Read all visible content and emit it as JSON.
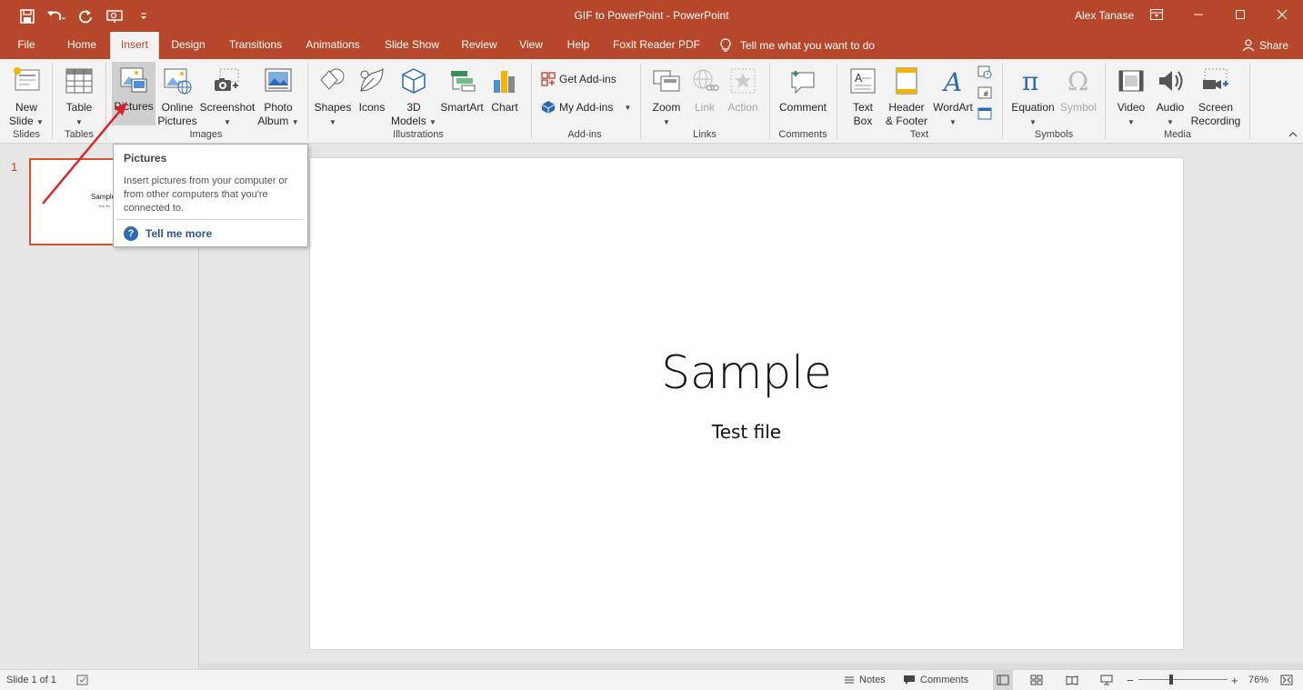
{
  "window": {
    "title": "GIF to PowerPoint  -  PowerPoint",
    "user": "Alex Tanase"
  },
  "tabs": [
    {
      "label": "File"
    },
    {
      "label": "Home"
    },
    {
      "label": "Insert"
    },
    {
      "label": "Design"
    },
    {
      "label": "Transitions"
    },
    {
      "label": "Animations"
    },
    {
      "label": "Slide Show"
    },
    {
      "label": "Review"
    },
    {
      "label": "View"
    },
    {
      "label": "Help"
    },
    {
      "label": "Foxit Reader PDF"
    }
  ],
  "active_tab": "Insert",
  "tell_me": "Tell me what you want to do",
  "share_label": "Share",
  "ribbon": {
    "new_slide": [
      "New",
      "Slide"
    ],
    "table": "Table",
    "pictures": "Pictures",
    "online_pictures": [
      "Online",
      "Pictures"
    ],
    "screenshot": "Screenshot",
    "photo_album": [
      "Photo",
      "Album"
    ],
    "shapes": "Shapes",
    "icons": "Icons",
    "models_3d": [
      "3D",
      "Models"
    ],
    "smartart": "SmartArt",
    "chart": "Chart",
    "get_addins": "Get Add-ins",
    "my_addins": "My Add-ins",
    "zoom": "Zoom",
    "link": "Link",
    "action": "Action",
    "comment": "Comment",
    "text_box": [
      "Text",
      "Box"
    ],
    "header_footer": [
      "Header",
      "& Footer"
    ],
    "wordart": "WordArt",
    "equation": "Equation",
    "symbol": "Symbol",
    "video": "Video",
    "audio": "Audio",
    "screen_recording": [
      "Screen",
      "Recording"
    ],
    "groups": {
      "slides": "Slides",
      "tables": "Tables",
      "images": "Images",
      "illustrations": "Illustrations",
      "addins": "Add-ins",
      "links": "Links",
      "comments": "Comments",
      "text": "Text",
      "symbols": "Symbols",
      "media": "Media"
    }
  },
  "tooltip": {
    "title": "Pictures",
    "description": "Insert pictures from your computer or from other computers that you're connected to.",
    "more": "Tell me more"
  },
  "slides_pane": {
    "slide_number": "1",
    "thumb_title": "Sample",
    "thumb_subtitle": "Test file"
  },
  "slide": {
    "title": "Sample",
    "subtitle": "Test file"
  },
  "status": {
    "slide_of": "Slide 1 of 1",
    "notes": "Notes",
    "comments": "Comments",
    "zoom": "76%"
  },
  "colors": {
    "accent": "#b7472a",
    "arrow": "#d9252a",
    "link_blue": "#2b579a"
  }
}
